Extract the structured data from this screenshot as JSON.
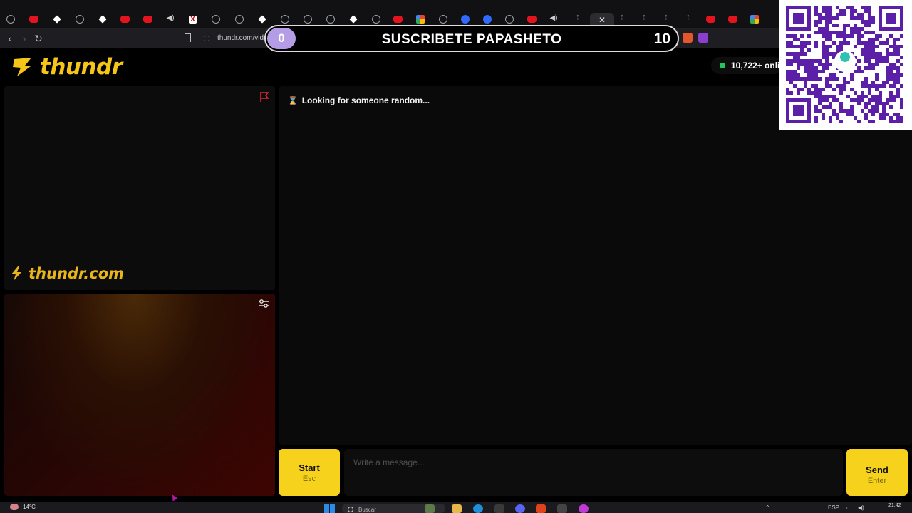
{
  "browser": {
    "url": "thundr.com/vide"
  },
  "overlay": {
    "counter_left": "0",
    "banner_text": "SUSCRIBETE PAPASHETO",
    "counter_right": "10"
  },
  "brand": {
    "logo_text": "thundr",
    "watermark_text": "thundr.com",
    "accent_color": "#f5c518"
  },
  "header": {
    "online_count": "10,722+ onli"
  },
  "chat": {
    "status_text": "Looking for someone random...",
    "status_icon": "hourglass-icon",
    "message_placeholder": "Write a message..."
  },
  "controls": {
    "start_label": "Start",
    "start_shortcut": "Esc",
    "send_label": "Send",
    "send_shortcut": "Enter"
  },
  "taskbar": {
    "temperature": "14°C",
    "search_placeholder": "Buscar",
    "language": "ESP",
    "time": "21:42"
  }
}
